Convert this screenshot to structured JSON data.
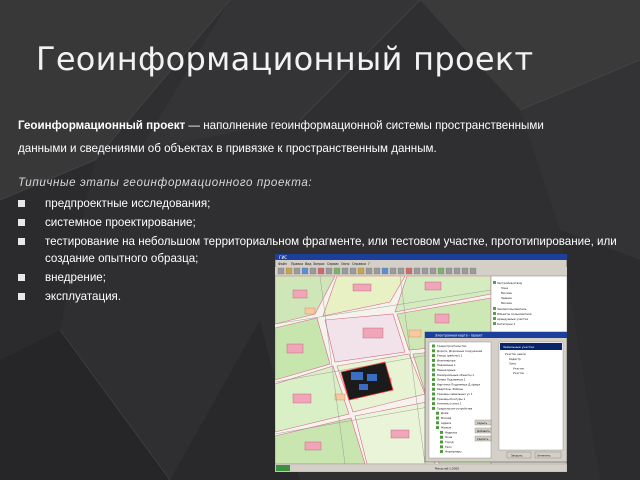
{
  "slide": {
    "title": "Геоинформационный проект",
    "definition": {
      "term": "Геоинформационный проект",
      "dash": " — ",
      "text_line1": "наполнение геоинформационной системы пространственными",
      "text_line2": "данными и сведениями об объектах в привязке к пространственным данным."
    },
    "stages_heading": "Типичные этапы геоинформационного проекта:",
    "stages": [
      {
        "text": "предпроектные исследования;"
      },
      {
        "text": "системное проектирование;"
      },
      {
        "text": "тестирование на небольшом территориальном фрагменте, или тестовом участке, прототипирование, или создание опытного образца;"
      },
      {
        "text": "внедрение;"
      },
      {
        "text": "эксплуатация."
      }
    ]
  },
  "screenshot": {
    "app_title": "ГИС",
    "menu": [
      "Файл",
      "Правка",
      "Вид",
      "Запрос",
      "Сервис",
      "Окно",
      "Справка",
      "?"
    ],
    "dialog_title": "Электронная карта - проект",
    "dialog_list": [
      "Градостроительство",
      "Дороги, Дорожные сооружения",
      "Улицы (районы) 1",
      "Инженерные",
      "Надземные 1",
      "Пешеходные",
      "Коммунальные объекты 1",
      "Линии Подземные 1",
      "Карточки Подземных Д.сфера",
      "Кварталы, Районы",
      "Границы земельных уч 1",
      "Границы Контуры 1",
      "Антенны (сети) 1",
      "Градостроит-устройства",
      "Дома",
      "Москва",
      "Адреса",
      "Жилые",
      "Надписи",
      "Окна",
      "Город",
      "Тело",
      "Формуляры"
    ],
    "dialog_right_title": "Земельные участки",
    "dialog_right_list": [
      "Участок земли",
      "Кадастр",
      "Зона",
      "Участок",
      "Участок"
    ],
    "dialog_buttons": [
      "Скрыть",
      "Добавить",
      "Удалить",
      "Закрыть",
      "Отменить"
    ],
    "side_panel_list": [
      "Застройка/отвод",
      "Зона",
      "Москва",
      "Здание",
      "Москва",
      "Землепользователь",
      "Объекты пользователя",
      "Арендуемые участки",
      "Категории 1"
    ],
    "statusbar": "Масштаб 1:2000"
  }
}
